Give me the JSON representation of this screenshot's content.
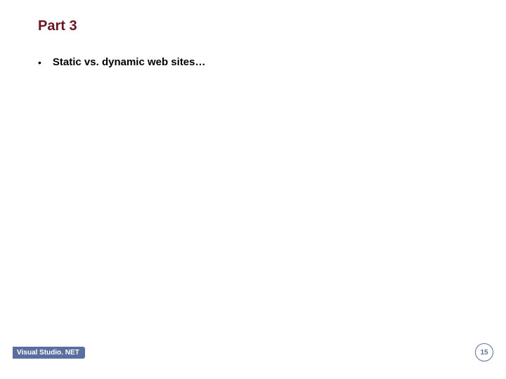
{
  "slide": {
    "title": "Part 3",
    "bullets": [
      {
        "text": "Static vs. dynamic web sites…"
      }
    ]
  },
  "footer": {
    "product": "Visual Studio. NET",
    "page_number": "15"
  }
}
